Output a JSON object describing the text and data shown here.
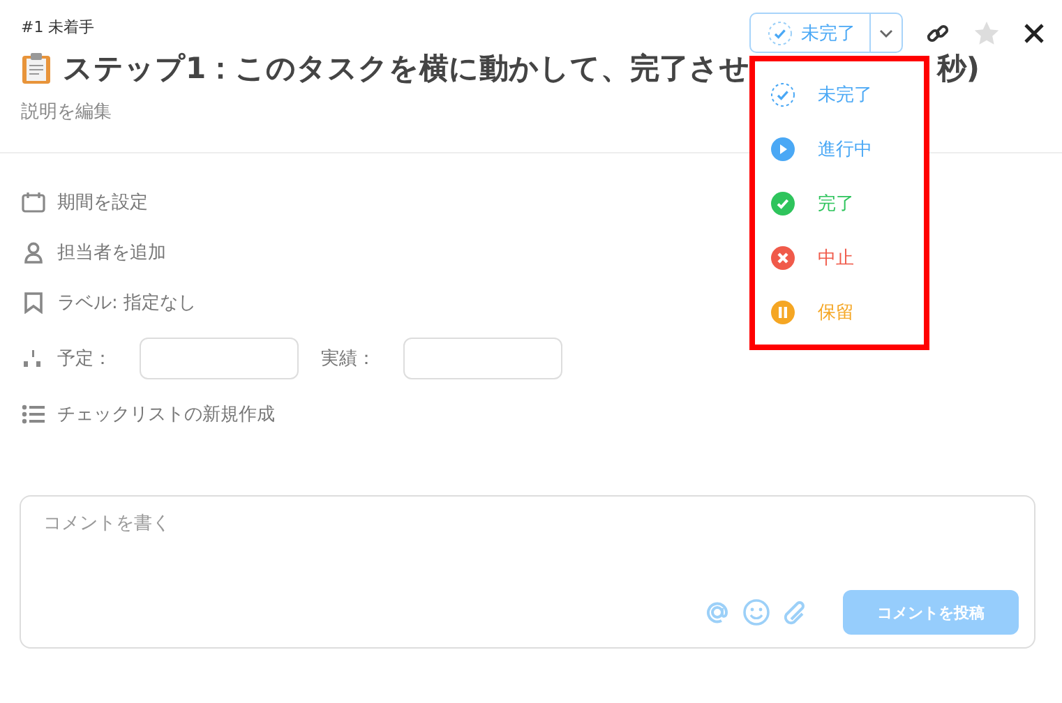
{
  "header": {
    "status_button": {
      "label": "未完了"
    },
    "task_ref": "#1 未着手",
    "title": "ステップ1：このタスクを横に動かして、完了させ",
    "title_tail": "秒)",
    "description_link": "説明を編集"
  },
  "status_menu": [
    {
      "kind": "todo",
      "label": "未完了",
      "color": "#4aa8f5"
    },
    {
      "kind": "doing",
      "label": "進行中",
      "color": "#4aa8f5"
    },
    {
      "kind": "done",
      "label": "完了",
      "color": "#2ec45c"
    },
    {
      "kind": "stop",
      "label": "中止",
      "color": "#f05a4a"
    },
    {
      "kind": "hold",
      "label": "保留",
      "color": "#f5a623"
    }
  ],
  "properties": [
    {
      "kind": "calendar",
      "label": "期間を設定"
    },
    {
      "kind": "person",
      "label": "担当者を追加"
    },
    {
      "kind": "bookmark",
      "label": "ラベル: 指定なし"
    }
  ],
  "estimates": {
    "planned_label": "予定：",
    "actual_label": "実績："
  },
  "checklist": {
    "label": "チェックリストの新規作成"
  },
  "comment": {
    "placeholder": "コメントを書く",
    "submit": "コメントを投稿"
  }
}
